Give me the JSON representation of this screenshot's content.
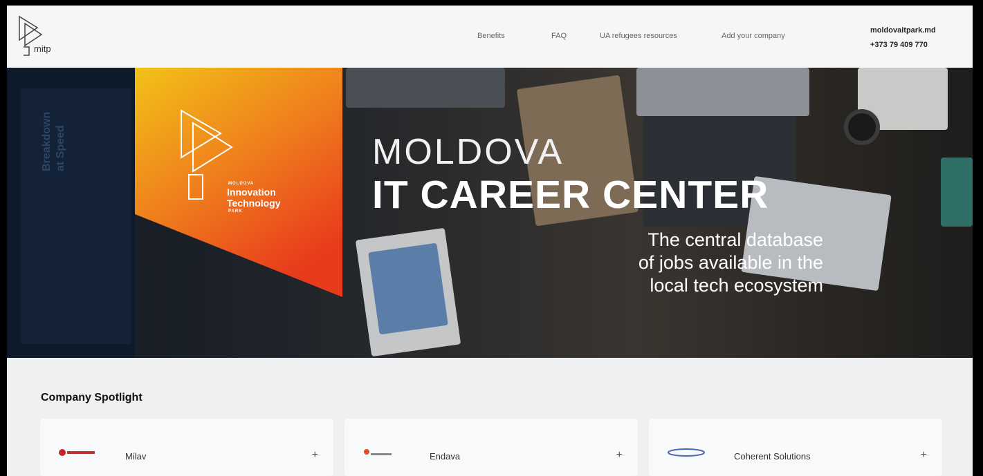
{
  "header": {
    "logo_text": "mitp",
    "nav": [
      "Benefits",
      "FAQ",
      "UA refugees resources",
      "Add your company"
    ],
    "contact": {
      "site": "moldovaitpark.md",
      "phone": "+373 79 409 770"
    }
  },
  "hero": {
    "banner": {
      "small": "MOLDOVA",
      "name_line1": "Innovation",
      "name_line2": "Technology",
      "park": "PARK"
    },
    "title": "MOLDOVA",
    "subtitle": "IT CAREER CENTER",
    "description": [
      "The central database",
      "of jobs available in the",
      "local tech ecosystem"
    ],
    "background_text": [
      "Breakdown",
      "at Speed"
    ]
  },
  "spotlight": {
    "title": "Company Spotlight",
    "companies": [
      {
        "name": "Milav",
        "logo_icon": "milav-logo-icon",
        "action": "+"
      },
      {
        "name": "Endava",
        "logo_icon": "endava-logo-icon",
        "action": "+"
      },
      {
        "name": "Coherent Solutions",
        "logo_icon": "coherent-logo-icon",
        "action": "+"
      }
    ]
  },
  "colors": {
    "banner_top": "#f2c218",
    "banner_bottom": "#e83a1c",
    "header_bg": "#f5f6f7",
    "section_bg": "#eef0f2"
  }
}
